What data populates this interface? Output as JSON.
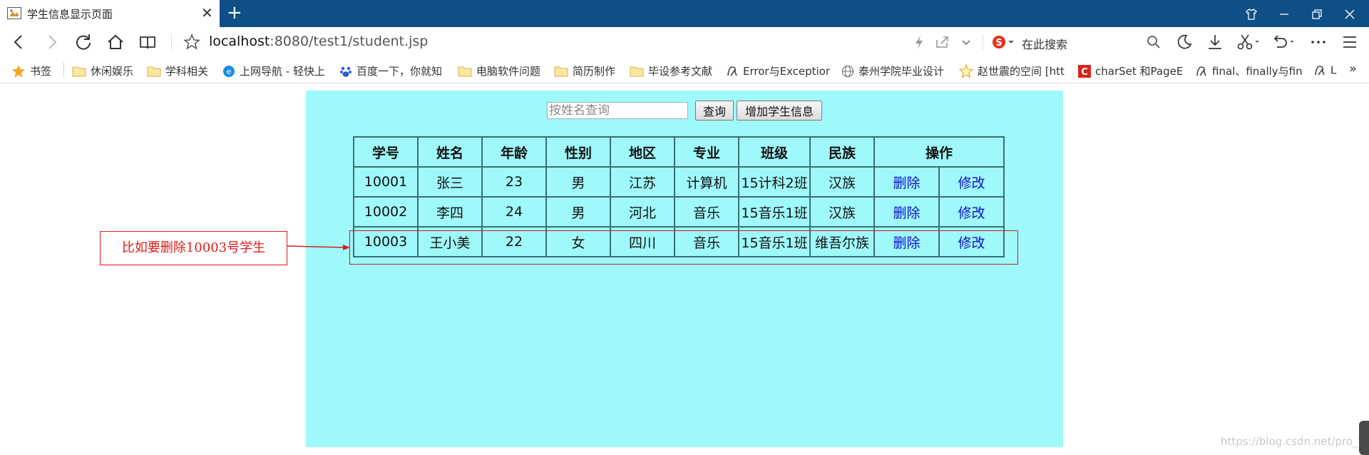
{
  "browser": {
    "tab_title": "学生信息显示页面",
    "tab_close": "✕",
    "new_tab": "+",
    "address": {
      "host": "localhost",
      "port_path": ":8080/test1/student.jsp"
    },
    "search_placeholder": "在此搜索",
    "bookmarks": [
      {
        "label": "书签",
        "icon": "star-icon"
      },
      {
        "label": "休闲娱乐",
        "icon": "folder-icon"
      },
      {
        "label": "学科相关",
        "icon": "folder-icon"
      },
      {
        "label": "上网导航 - 轻快上",
        "icon": "ie-icon"
      },
      {
        "label": "百度一下，你就知",
        "icon": "baidu-icon"
      },
      {
        "label": "电脑软件问题",
        "icon": "folder-icon"
      },
      {
        "label": "简历制作",
        "icon": "folder-icon"
      },
      {
        "label": "毕设参考文献",
        "icon": "folder-icon"
      },
      {
        "label": "Error与Exception",
        "icon": "csdn-icon"
      },
      {
        "label": "泰州学院毕业设计",
        "icon": "globe-icon"
      },
      {
        "label": "赵世震的空间 [htt",
        "icon": "star-outline-icon"
      },
      {
        "label": "charSet 和PageE",
        "icon": "c-red-icon"
      },
      {
        "label": "final、finally与fin",
        "icon": "csdn-icon"
      },
      {
        "label": "L",
        "icon": "csdn-icon"
      }
    ],
    "bookmarks_more": "»"
  },
  "page": {
    "search_input_placeholder": "按姓名查询",
    "query_button": "查询",
    "add_button": "增加学生信息",
    "table": {
      "headers": [
        "学号",
        "姓名",
        "年龄",
        "性别",
        "地区",
        "专业",
        "班级",
        "民族",
        "操作"
      ],
      "rows": [
        {
          "id": "10001",
          "name": "张三",
          "age": "23",
          "gender": "男",
          "region": "江苏",
          "major": "计算机",
          "class": "15计科2班",
          "ethnicity": "汉族",
          "delete": "删除",
          "edit": "修改"
        },
        {
          "id": "10002",
          "name": "李四",
          "age": "24",
          "gender": "男",
          "region": "河北",
          "major": "音乐",
          "class": "15音乐1班",
          "ethnicity": "汉族",
          "delete": "删除",
          "edit": "修改"
        },
        {
          "id": "10003",
          "name": "王小美",
          "age": "22",
          "gender": "女",
          "region": "四川",
          "major": "音乐",
          "class": "15音乐1班",
          "ethnicity": "维吾尔族",
          "delete": "删除",
          "edit": "修改"
        }
      ]
    },
    "annotation": "比如要删除10003号学生",
    "watermark": "https://blog.csdn.net/pro_fan"
  },
  "colors": {
    "titlebar": "#0e4f87",
    "content_bg": "#9ff8fa",
    "link": "#1010d0",
    "annotation": "#e11a1a"
  }
}
